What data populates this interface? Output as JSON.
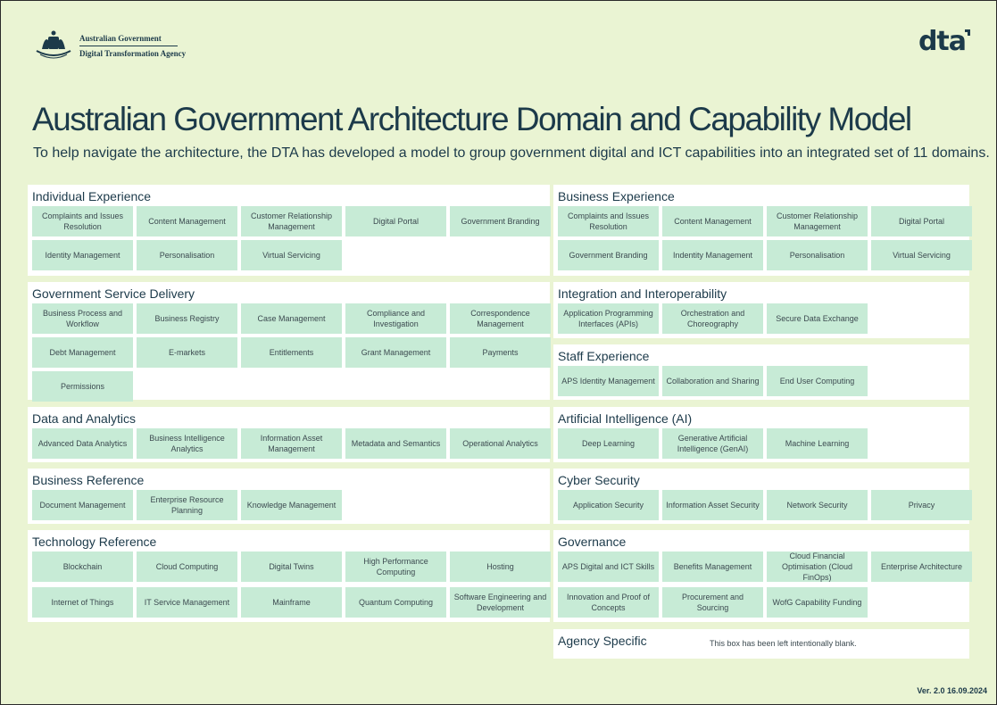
{
  "header": {
    "gov_name": "Australian Government",
    "agency_name": "Digital Transformation Agency",
    "brand_logo": "dta",
    "crest_icon": "coat-of-arms-icon"
  },
  "title": "Australian Government Architecture Domain and Capability Model",
  "subtitle": "To help navigate the architecture, the DTA has developed a model to group government digital and ICT capabilities into an integrated set of 11 domains.",
  "colors": {
    "background": "#eaf4d3",
    "panel": "#ffffff",
    "card": "#c7ebd6",
    "text": "#1c3a4a"
  },
  "domains": {
    "individual_experience": {
      "title": "Individual Experience",
      "capabilities": [
        "Complaints and Issues Resolution",
        "Content Management",
        "Customer Relationship Management",
        "Digital Portal",
        "Government Branding",
        "Identity Management",
        "Personalisation",
        "Virtual Servicing"
      ]
    },
    "business_experience": {
      "title": "Business Experience",
      "capabilities": [
        "Complaints and Issues Resolution",
        "Content Management",
        "Customer Relationship Management",
        "Digital Portal",
        "Government Branding",
        "Indentity Management",
        "Personalisation",
        "Virtual Servicing"
      ]
    },
    "government_service_delivery": {
      "title": "Government Service Delivery",
      "capabilities": [
        "Business Process and Workflow",
        "Business Registry",
        "Case Management",
        "Compliance and Investigation",
        "Correspondence Management",
        "Debt Management",
        "E-markets",
        "Entitlements",
        "Grant Management",
        "Payments",
        "Permissions"
      ]
    },
    "integration_interoperability": {
      "title": "Integration and Interoperability",
      "capabilities": [
        "Application Programming Interfaces (APIs)",
        "Orchestration and Choreography",
        "Secure Data Exchange"
      ]
    },
    "staff_experience": {
      "title": "Staff Experience",
      "capabilities": [
        "APS Identity Management",
        "Collaboration and Sharing",
        "End User Computing"
      ]
    },
    "data_analytics": {
      "title": "Data and Analytics",
      "capabilities": [
        "Advanced Data Analytics",
        "Business Intelligence Analytics",
        "Information Asset Management",
        "Metadata and Semantics",
        "Operational Analytics"
      ]
    },
    "artificial_intelligence": {
      "title": "Artificial Intelligence (AI)",
      "capabilities": [
        "Deep Learning",
        "Generative Artificial Intelligence (GenAI)",
        "Machine Learning"
      ]
    },
    "business_reference": {
      "title": "Business Reference",
      "capabilities": [
        "Document Management",
        "Enterprise Resource Planning",
        "Knowledge Management"
      ]
    },
    "cyber_security": {
      "title": "Cyber Security",
      "capabilities": [
        "Application Security",
        "Information Asset Security",
        "Network Security",
        "Privacy"
      ]
    },
    "technology_reference": {
      "title": "Technology Reference",
      "capabilities": [
        "Blockchain",
        "Cloud Computing",
        "Digital Twins",
        "High Performance Computing",
        "Hosting",
        "Internet of Things",
        "IT Service Management",
        "Mainframe",
        "Quantum Computing",
        "Software Engineering and Development"
      ]
    },
    "governance": {
      "title": "Governance",
      "capabilities": [
        "APS Digital and ICT Skills",
        "Benefits Management",
        "Cloud Financial Optimisation (Cloud FinOps)",
        "Enterprise Architecture",
        "Innovation and Proof of Concepts",
        "Procurement and Sourcing",
        "WofG Capability Funding"
      ]
    },
    "agency_specific": {
      "title": "Agency Specific",
      "note": "This box has been left intentionally blank."
    }
  },
  "footer": {
    "version": "Ver. 2.0  16.09.2024"
  }
}
